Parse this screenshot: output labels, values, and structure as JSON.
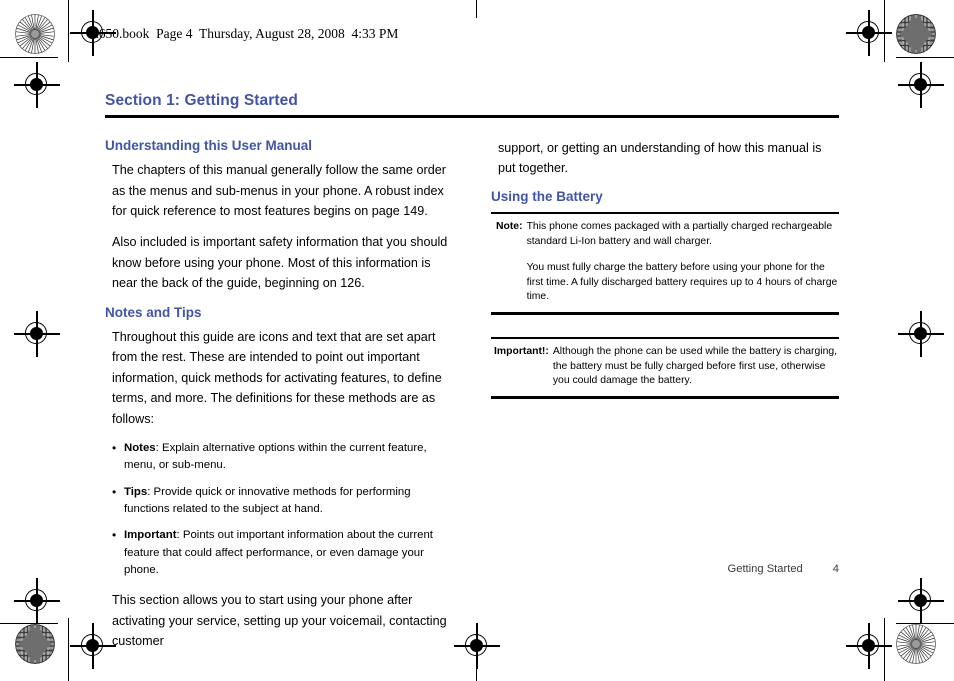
{
  "page": {
    "header_line": "u650.book  Page 4  Thursday, August 28, 2008  4:33 PM",
    "accent_color": "#4154a8"
  },
  "section": {
    "title": "Section 1: Getting Started"
  },
  "left_column": {
    "heading_1": "Understanding this User Manual",
    "para_1": "The chapters of this manual generally follow the same order as the menus and sub-menus in your phone. A robust index for quick reference to most features begins on page 149.",
    "para_2": "Also included is important safety information that you should know before using your phone. Most of this information is near the back of the guide, beginning on 126.",
    "heading_2": "Notes and Tips",
    "para_3": "Throughout this guide are icons and text that are set apart from the rest. These are intended to point out important information, quick methods for activating features, to define terms, and more. The definitions for these methods are as follows:",
    "bullets": [
      {
        "term": "Notes",
        "text": ": Explain alternative options within the current feature, menu, or sub-menu."
      },
      {
        "term": "Tips",
        "text": ": Provide quick or innovative methods for performing functions related to the subject at hand."
      },
      {
        "term": "Important",
        "text": ": Points out important information about the current feature that could affect performance, or even damage your phone."
      }
    ],
    "para_4": "This section allows you to start using your phone after activating your service, setting up your voicemail, contacting customer"
  },
  "right_column": {
    "para_continued": "support, or getting an understanding of how this manual is put together.",
    "heading_1": "Using the Battery",
    "note_callout": {
      "label": "Note:",
      "paragraph_1": "This phone comes packaged with a partially charged rechargeable standard Li-Ion battery and wall charger.",
      "paragraph_2": "You must fully charge the battery before using your phone for the first time. A fully discharged battery requires up to 4 hours of charge time."
    },
    "important_callout": {
      "label": "Important!:",
      "paragraph_1": "Although the phone can be used while the battery is charging, the battery must be fully charged before first use, otherwise you could damage the battery."
    }
  },
  "footer": {
    "section_label": "Getting Started",
    "page_number": "4"
  }
}
